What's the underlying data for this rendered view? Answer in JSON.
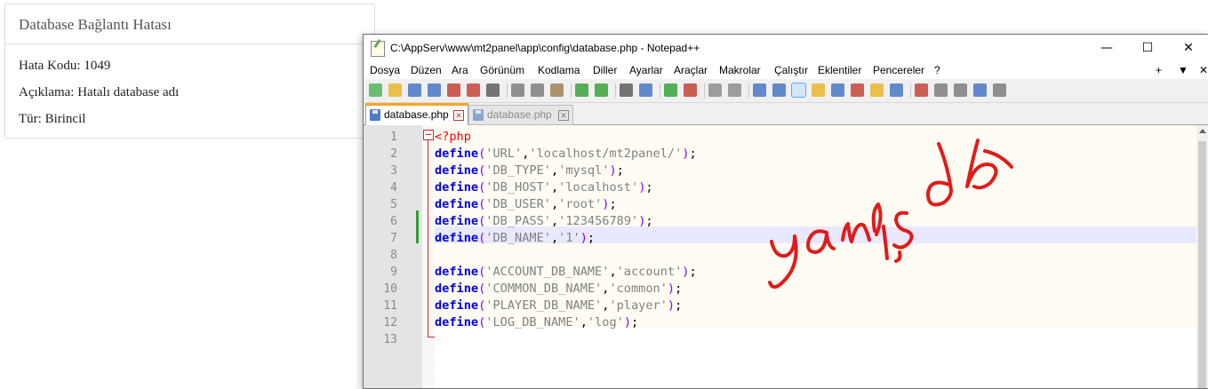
{
  "error_panel": {
    "title": "Database Bağlantı Hatası",
    "code_line": "Hata Kodu: 1049",
    "desc_line": "Açıklama: Hatalı database adı",
    "type_line": "Tür: Birincil"
  },
  "window": {
    "title": "C:\\AppServ\\www\\mt2panel\\app\\config\\database.php - Notepad++",
    "minimize": "—",
    "maximize": "☐",
    "close": "✕"
  },
  "menu": {
    "items": [
      "Dosya",
      "Düzen",
      "Ara",
      "Görünüm",
      "Kodlama",
      "Diller",
      "Ayarlar",
      "Araçlar",
      "Makrolar",
      "Çalıştır",
      "Eklentiler",
      "Pencereler",
      "?"
    ],
    "right": [
      "+",
      "▼",
      "✕"
    ]
  },
  "tabs": [
    {
      "label": "database.php",
      "close": "✕"
    },
    {
      "label": "database.php",
      "close": "✕"
    }
  ],
  "editor": {
    "line_numbers": [
      "1",
      "2",
      "3",
      "4",
      "5",
      "6",
      "7",
      "8",
      "9",
      "10",
      "11",
      "12",
      "13"
    ],
    "lines": [
      {
        "php": "<?php"
      },
      {
        "kw": "define",
        "arg1": "'URL'",
        "arg2": "'localhost/mt2panel/'"
      },
      {
        "kw": "define",
        "arg1": "'DB_TYPE'",
        "arg2": "'mysql'"
      },
      {
        "kw": "define",
        "arg1": "'DB_HOST'",
        "arg2": "'localhost'"
      },
      {
        "kw": "define",
        "arg1": "'DB_USER'",
        "arg2": "'root'"
      },
      {
        "kw": "define",
        "arg1": "'DB_PASS'",
        "arg2": "'123456789'"
      },
      {
        "kw": "define",
        "arg1": "'DB_NAME'",
        "arg2": "'1'"
      },
      {},
      {
        "kw": "define",
        "arg1": "'ACCOUNT_DB_NAME'",
        "arg2": "'account'"
      },
      {
        "kw": "define",
        "arg1": "'COMMON_DB_NAME'",
        "arg2": "'common'"
      },
      {
        "kw": "define",
        "arg1": "'PLAYER_DB_NAME'",
        "arg2": "'player'"
      },
      {
        "kw": "define",
        "arg1": "'LOG_DB_NAME'",
        "arg2": "'log'"
      },
      {}
    ],
    "punct": {
      "open": "(",
      "comma": ",",
      "close": ")",
      "semi": ";"
    }
  },
  "annotation": {
    "handwritten_text": "yanlış db",
    "color": "#e01b1b"
  },
  "colors": {
    "keyword": "#0000e0",
    "string": "#808080",
    "paren": "#8000ff",
    "php_tag": "#ff0000",
    "active_tab_accent": "#f5a623",
    "current_line": "#e8e8ff"
  },
  "toolbar_icons": [
    "new-file-icon",
    "open-file-icon",
    "save-icon",
    "save-all-icon",
    "close-icon",
    "close-all-icon",
    "print-icon",
    "cut-icon",
    "copy-icon",
    "paste-icon",
    "undo-icon",
    "redo-icon",
    "find-icon",
    "replace-icon",
    "zoom-in-icon",
    "zoom-out-icon",
    "sync-vertical-icon",
    "sync-horizontal-icon",
    "word-wrap-icon",
    "show-all-chars-icon",
    "indent-guide-icon",
    "user-lang-icon",
    "doc-map-icon",
    "function-list-icon",
    "folder-workspace-icon",
    "monitor-icon",
    "record-macro-icon",
    "stop-macro-icon",
    "play-macro-icon",
    "run-macro-multiple-icon",
    "save-macro-icon"
  ]
}
